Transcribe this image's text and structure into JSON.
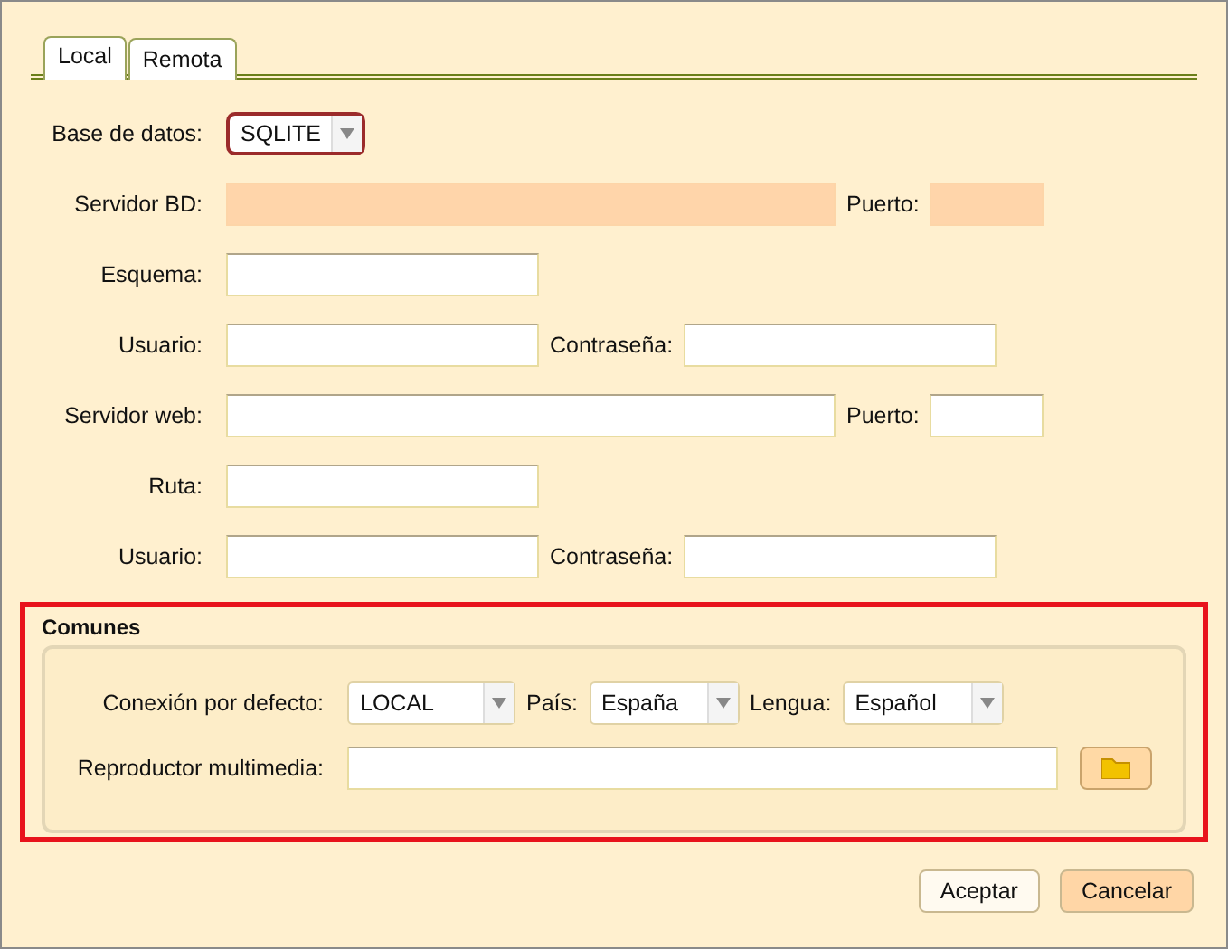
{
  "tabs": [
    {
      "label": "Local",
      "selected": true
    },
    {
      "label": "Remota",
      "selected": false
    }
  ],
  "database": {
    "label": "Base de datos:",
    "value": "SQLITE"
  },
  "rows": [
    {
      "fields": [
        {
          "label": "Servidor BD:",
          "kind": "long",
          "disabled": true
        },
        {
          "label": "Puerto:",
          "kind": "short",
          "disabled": true
        }
      ]
    },
    {
      "fields": [
        {
          "label": "Esquema:",
          "kind": "medium",
          "disabled": false
        }
      ]
    },
    {
      "fields": [
        {
          "label": "Usuario:",
          "kind": "medium",
          "disabled": false
        },
        {
          "label": "Contraseña:",
          "kind": "medium",
          "disabled": false
        }
      ]
    },
    {
      "fields": [
        {
          "label": "Servidor web:",
          "kind": "long",
          "disabled": false
        },
        {
          "label": "Puerto:",
          "kind": "short",
          "disabled": false
        }
      ]
    },
    {
      "fields": [
        {
          "label": "Ruta:",
          "kind": "medium",
          "disabled": false
        }
      ]
    },
    {
      "fields": [
        {
          "label": "Usuario:",
          "kind": "medium",
          "disabled": false
        },
        {
          "label": "Contraseña:",
          "kind": "medium",
          "disabled": false
        }
      ]
    }
  ],
  "common": {
    "title": "Comunes",
    "selects": [
      {
        "label": "Conexión por defecto:",
        "value": "LOCAL"
      },
      {
        "label": "País:",
        "value": "España"
      },
      {
        "label": "Lengua:",
        "value": "Español"
      }
    ],
    "player": {
      "label": "Reproductor multimedia:"
    }
  },
  "buttons": [
    {
      "label": "Aceptar",
      "primary": false
    },
    {
      "label": "Cancelar",
      "primary": true
    }
  ]
}
